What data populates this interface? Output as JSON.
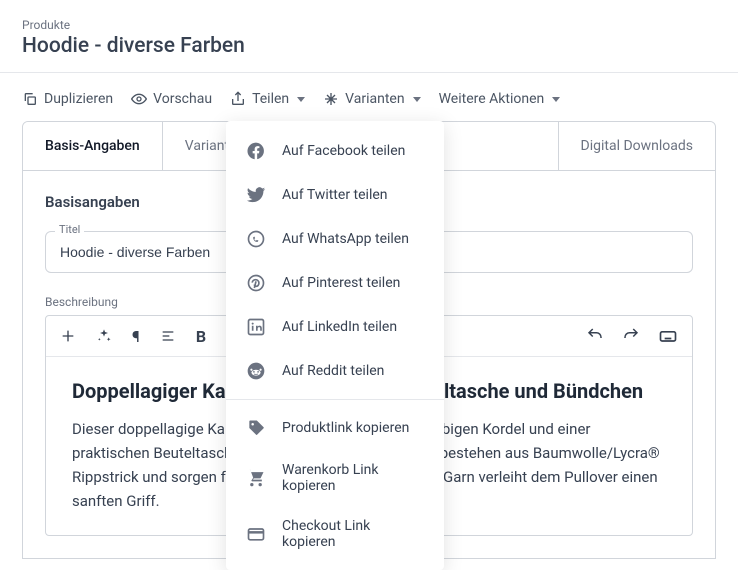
{
  "breadcrumb": "Produkte",
  "title": "Hoodie - diverse Farben",
  "toolbar": {
    "duplizieren": "Duplizieren",
    "vorschau": "Vorschau",
    "teilen": "Teilen",
    "varianten": "Varianten",
    "weitere": "Weitere Aktionen"
  },
  "shareMenu": {
    "facebook": "Auf Facebook teilen",
    "twitter": "Auf Twitter teilen",
    "whatsapp": "Auf WhatsApp teilen",
    "pinterest": "Auf Pinterest teilen",
    "linkedin": "Auf LinkedIn teilen",
    "reddit": "Auf Reddit teilen",
    "produktlink": "Produktlink kopieren",
    "warenkorb": "Warenkorb Link kopieren",
    "checkout": "Checkout Link kopieren"
  },
  "tabs": {
    "basis": "Basis-Angaben",
    "varianten": "Varianten",
    "downloads": "Digital Downloads"
  },
  "panel": {
    "sectionTitle": "Basisangaben",
    "titelLabel": "Titel",
    "titelValue": "Hoodie - diverse Farben",
    "beschreibungLabel": "Beschreibung",
    "bodyHeading": "Doppellagiger Kapuzenpullover mit Beuteltasche und Bündchen",
    "bodyText": "Dieser doppellagige Kapuzenpullover mit einer gleichfarbigen Kordel und einer praktischen Beuteltasche. Der Saum und die Bündchen bestehen aus Baumwolle/Lycra® Rippstrick und sorgen für eine Passform. Das Belcoro® Garn verleiht dem Pullover einen sanften Griff."
  }
}
